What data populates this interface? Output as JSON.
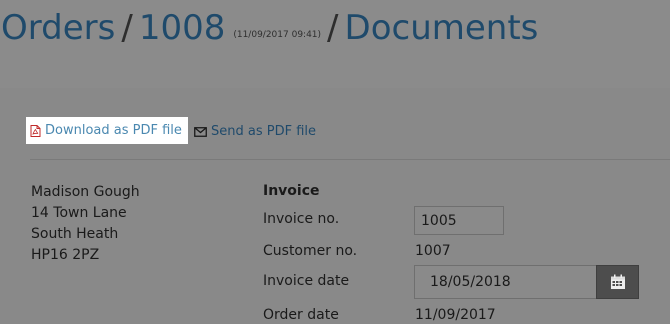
{
  "header": {
    "crumb_orders": "Orders",
    "crumb_order_id": "1008",
    "order_timestamp": "(11/09/2017 09:41)",
    "crumb_documents": "Documents",
    "separator": "/"
  },
  "actions": {
    "download_pdf": "Download as PDF file",
    "send_pdf": "Send as PDF file"
  },
  "address": {
    "name": "Madison Gough",
    "line1": "14 Town Lane",
    "line2": "South Heath",
    "postcode": "HP16 2PZ"
  },
  "invoice": {
    "heading": "Invoice",
    "invoice_no_label": "Invoice no.",
    "invoice_no_value": "1005",
    "customer_no_label": "Customer no.",
    "customer_no_value": "1007",
    "invoice_date_label": "Invoice date",
    "invoice_date_value": "18/05/2018",
    "order_date_label": "Order date",
    "order_date_value": "11/09/2017"
  },
  "icons": {
    "download": "pdf-file-icon",
    "send": "envelope-icon",
    "calendar": "calendar-icon"
  }
}
